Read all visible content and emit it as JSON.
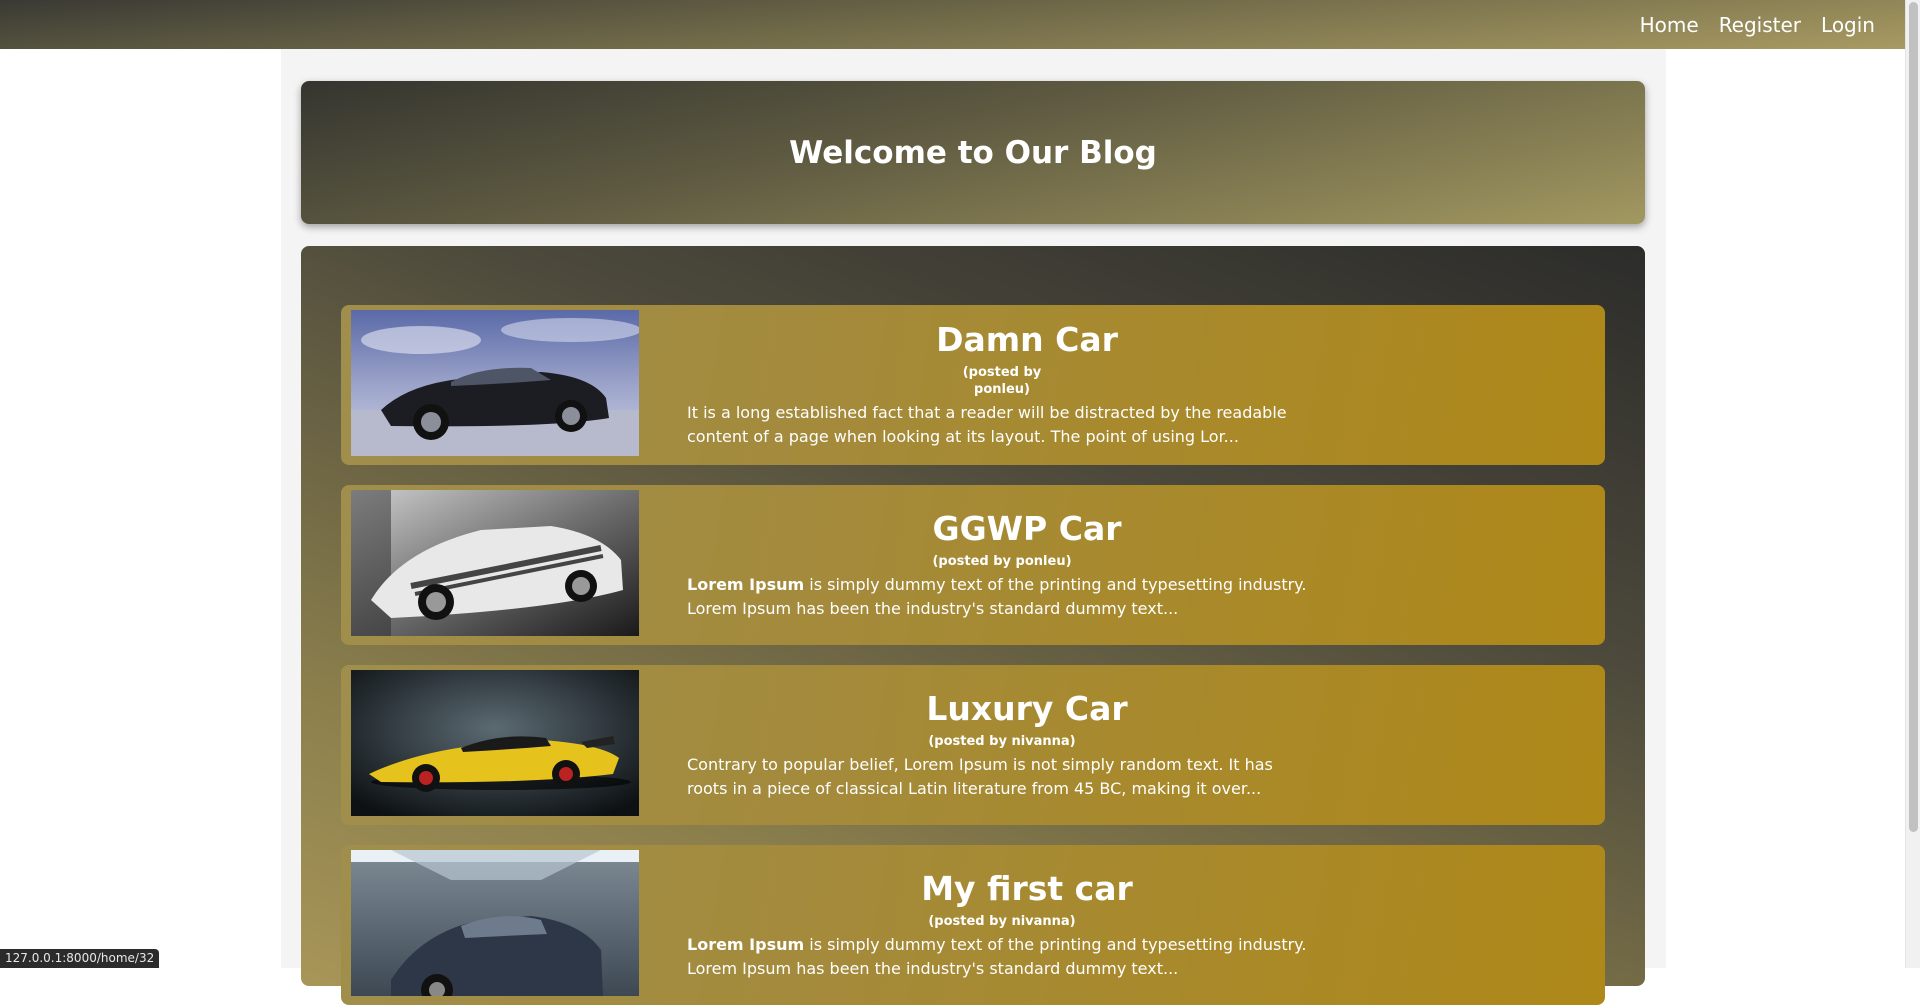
{
  "nav": {
    "home": "Home",
    "register": "Register",
    "login": "Login"
  },
  "hero": {
    "title": "Welcome to Our Blog"
  },
  "posts": [
    {
      "title": "Damn Car",
      "author_line1": "(posted by",
      "author_line2": "ponleu)",
      "excerpt_bold": "",
      "excerpt": "It is a long established fact that a reader will be distracted by the readable content of a page when looking at its layout. The point of using Lor..."
    },
    {
      "title": "GGWP Car",
      "author_line1": "(posted by ponleu)",
      "author_line2": "",
      "excerpt_bold": "Lorem Ipsum",
      "excerpt": " is simply dummy text of the printing and typesetting industry. Lorem Ipsum has been the industry's standard dummy text..."
    },
    {
      "title": "Luxury Car",
      "author_line1": "(posted by nivanna)",
      "author_line2": "",
      "excerpt_bold": "",
      "excerpt": "Contrary to popular belief, Lorem Ipsum is not simply random text. It has roots in a piece of classical Latin literature from 45 BC, making it over..."
    },
    {
      "title": "My first car",
      "author_line1": "(posted by nivanna)",
      "author_line2": "",
      "excerpt_bold": "Lorem Ipsum",
      "excerpt": " is simply dummy text of the printing and typesetting industry. Lorem Ipsum has been the industry's standard dummy text..."
    }
  ],
  "status_bar": {
    "url": "127.0.0.1:8000/home/32"
  }
}
